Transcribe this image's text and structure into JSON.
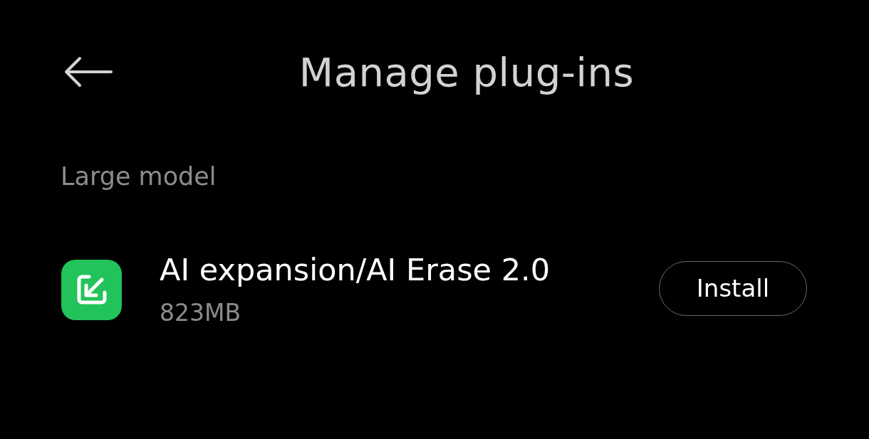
{
  "header": {
    "title": "Manage plug-ins"
  },
  "section": {
    "title": "Large model"
  },
  "plugins": [
    {
      "name": "AI expansion/AI Erase 2.0",
      "size": "823MB",
      "action": "Install"
    }
  ]
}
